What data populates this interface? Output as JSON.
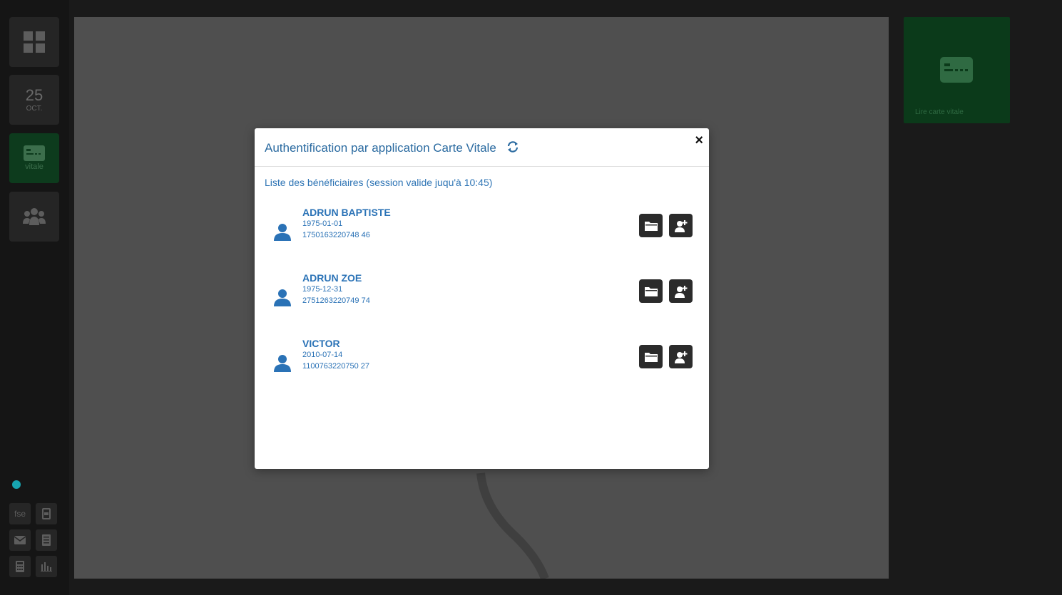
{
  "sidebar": {
    "date_day": "25",
    "date_month": "OCT.",
    "vitale_label": "vitale",
    "bottom_items": [
      "fse",
      "mail",
      "calculator",
      "chart"
    ]
  },
  "reader": {
    "label": "Lire carte vitale"
  },
  "modal": {
    "title": "Authentification par application Carte Vitale",
    "close_label": "×",
    "subtitle": "Liste des bénéficiaires (session valide juqu'à 10:45)",
    "beneficiaries": [
      {
        "name": "ADRUN BAPTISTE",
        "birthdate": "1975-01-01",
        "nir": "1750163220748 46"
      },
      {
        "name": "ADRUN ZOE",
        "birthdate": "1975-12-31",
        "nir": "2751263220749 74"
      },
      {
        "name": "VICTOR",
        "birthdate": "2010-07-14",
        "nir": "1100763220750 27"
      }
    ]
  },
  "colors": {
    "accent": "#2a72b6",
    "teal_dot": "#17a5b1",
    "vitale_green": "#0b3a1a"
  },
  "icons": [
    "dashboard-icon",
    "vitale-card-icon",
    "group-icon",
    "refresh-icon",
    "close-icon",
    "user-icon",
    "folder-icon",
    "add-user-icon"
  ]
}
